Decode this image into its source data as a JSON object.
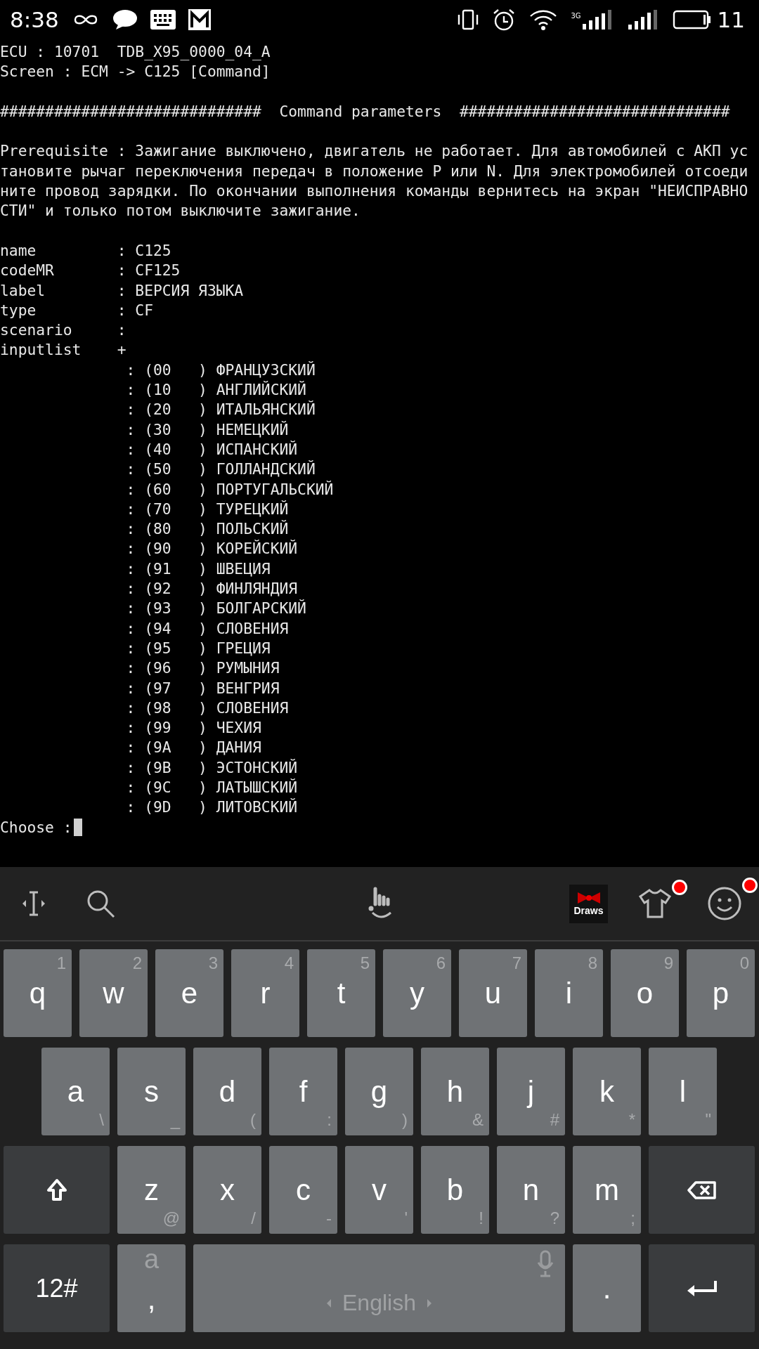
{
  "status_bar": {
    "time": "8:38",
    "battery_text": "11",
    "network_type": "3G"
  },
  "terminal": {
    "header": [
      "ECU : 10701  TDB_X95_0000_04_A",
      "Screen : ECM -> C125 [Command]"
    ],
    "section_title": "#############################  Command parameters  ##############################",
    "prerequisite": [
      "Prerequisite : Зажигание выключено, двигатель не работает. Для автомобилей с АКП ус",
      "тановите рычаг переключения передач в положение P или N. Для электромобилей отсоеди",
      "ните провод зарядки. По окончании выполнения команды вернитесь на экран \"НЕИСПРАВНО",
      "СТИ\" и только потом выключите зажигание."
    ],
    "params": [
      {
        "key": "name",
        "value": ": C125"
      },
      {
        "key": "codeMR",
        "value": ": CF125"
      },
      {
        "key": "label",
        "value": ": ВЕРСИЯ ЯЗЫКА"
      },
      {
        "key": "type",
        "value": ": CF"
      },
      {
        "key": "scenario",
        "value": ":"
      },
      {
        "key": "inputlist",
        "value": "+"
      }
    ],
    "inputlist": [
      ": (00   ) ФРАНЦУЗСКИЙ",
      ": (10   ) АНГЛИЙСКИЙ",
      ": (20   ) ИТАЛЬЯНСКИЙ",
      ": (30   ) НЕМЕЦКИЙ",
      ": (40   ) ИСПАНСКИЙ",
      ": (50   ) ГОЛЛАНДСКИЙ",
      ": (60   ) ПОРТУГАЛЬСКИЙ",
      ": (70   ) ТУРЕЦКИЙ",
      ": (80   ) ПОЛЬСКИЙ",
      ": (90   ) КОРЕЙСКИЙ",
      ": (91   ) ШВЕЦИЯ",
      ": (92   ) ФИНЛЯНДИЯ",
      ": (93   ) БОЛГАРСКИЙ",
      ": (94   ) СЛОВЕНИЯ",
      ": (95   ) ГРЕЦИЯ",
      ": (96   ) РУМЫНИЯ",
      ": (97   ) ВЕНГРИЯ",
      ": (98   ) СЛОВЕНИЯ",
      ": (99   ) ЧЕХИЯ",
      ": (9A   ) ДАНИЯ",
      ": (9B   ) ЭСТОНСКИЙ",
      ": (9C   ) ЛАТЫШСКИЙ",
      ": (9D   ) ЛИТОВСКИЙ"
    ],
    "prompt": "Choose :"
  },
  "keyboard": {
    "toolbar": {
      "sticker_label": "Draws",
      "shirt_badge": true,
      "emoji_badge": true
    },
    "rows": [
      {
        "kind": "top_hints",
        "keys": [
          {
            "kind": "letter",
            "main": "q",
            "hint": "1"
          },
          {
            "kind": "letter",
            "main": "w",
            "hint": "2"
          },
          {
            "kind": "letter",
            "main": "e",
            "hint": "3"
          },
          {
            "kind": "letter",
            "main": "r",
            "hint": "4"
          },
          {
            "kind": "letter",
            "main": "t",
            "hint": "5"
          },
          {
            "kind": "letter",
            "main": "y",
            "hint": "6"
          },
          {
            "kind": "letter",
            "main": "u",
            "hint": "7"
          },
          {
            "kind": "letter",
            "main": "i",
            "hint": "8"
          },
          {
            "kind": "letter",
            "main": "o",
            "hint": "9"
          },
          {
            "kind": "letter",
            "main": "p",
            "hint": "0"
          }
        ]
      },
      {
        "kind": "bottom_hints",
        "keys": [
          {
            "kind": "letter",
            "main": "a",
            "hint": "\\"
          },
          {
            "kind": "letter",
            "main": "s",
            "hint": "_"
          },
          {
            "kind": "letter",
            "main": "d",
            "hint": "("
          },
          {
            "kind": "letter",
            "main": "f",
            "hint": ":"
          },
          {
            "kind": "letter",
            "main": "g",
            "hint": ")"
          },
          {
            "kind": "letter",
            "main": "h",
            "hint": "&"
          },
          {
            "kind": "letter",
            "main": "j",
            "hint": "#"
          },
          {
            "kind": "letter",
            "main": "k",
            "hint": "*"
          },
          {
            "kind": "letter",
            "main": "l",
            "hint": "\""
          }
        ]
      },
      {
        "kind": "bottom_hints",
        "keys": [
          {
            "kind": "shift"
          },
          {
            "kind": "letter",
            "main": "z",
            "hint": "@"
          },
          {
            "kind": "letter",
            "main": "x",
            "hint": "/"
          },
          {
            "kind": "letter",
            "main": "c",
            "hint": "-"
          },
          {
            "kind": "letter",
            "main": "v",
            "hint": "'"
          },
          {
            "kind": "letter",
            "main": "b",
            "hint": "!"
          },
          {
            "kind": "letter",
            "main": "n",
            "hint": "?"
          },
          {
            "kind": "letter",
            "main": "m",
            "hint": ";"
          },
          {
            "kind": "backspace"
          }
        ]
      },
      {
        "kind": "controls",
        "keys": [
          {
            "kind": "symbols",
            "main": "12#"
          },
          {
            "kind": "comma",
            "main": ",",
            "hint": "a"
          },
          {
            "kind": "space",
            "main": "English"
          },
          {
            "kind": "period",
            "main": "."
          },
          {
            "kind": "enter"
          }
        ]
      }
    ]
  }
}
